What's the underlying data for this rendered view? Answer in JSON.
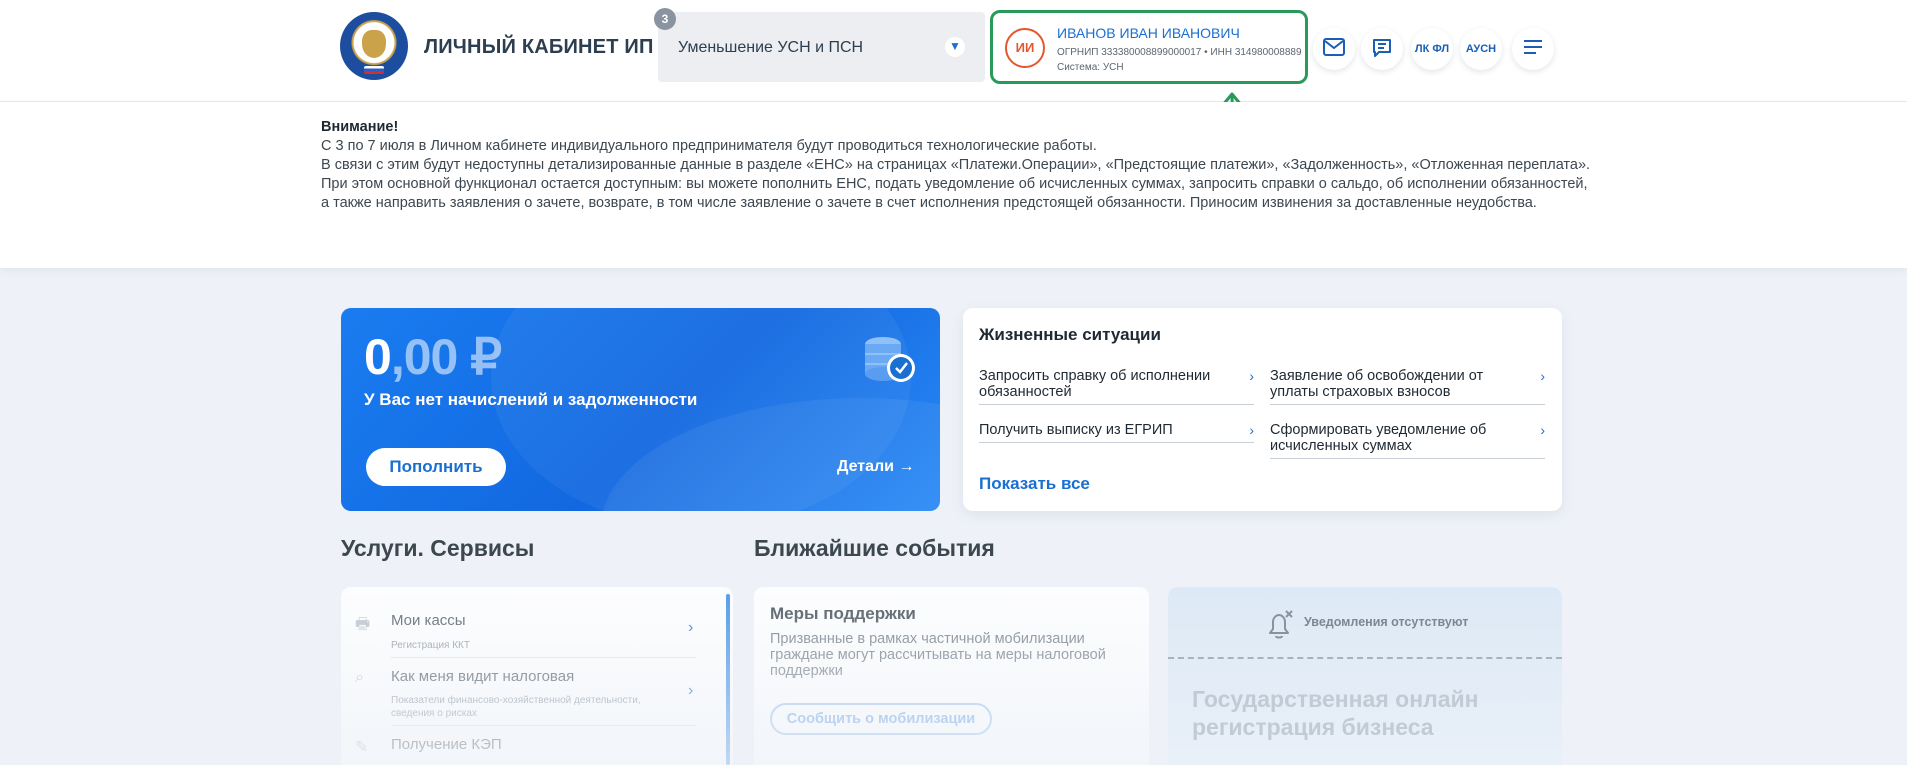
{
  "header": {
    "brand": "ЛИЧНЫЙ КАБИНЕТ ИП",
    "selector": {
      "badge": "3",
      "label": "Уменьшение УСН и ПСН"
    },
    "profile": {
      "initials": "ИИ",
      "name": "ИВАНОВ ИВАН ИВАНОВИЧ",
      "ids": "ОГРНИП 333380008899000017 • ИНН 314980008889",
      "system": "Система: УСН"
    },
    "buttons": {
      "lk_fl": "ЛК ФЛ",
      "ausn": "АУСН"
    }
  },
  "notice": {
    "title": "Внимание!",
    "lines": [
      "С 3 по 7 июля в Личном кабинете индивидуального предпринимателя будут проводиться технологические работы.",
      "В связи с этим будут недоступны детализированные данные в разделе «ЕНС» на страницах «Платежи.Операции», «Предстоящие платежи», «Задолженность», «Отложенная переплата».",
      "При этом основной функционал остается доступным: вы можете пополнить ЕНС, подать уведомление об исчисленных суммах, запросить справки о сальдо, об исполнении обязанностей, а также направить заявления о зачете, возврате, в том числе заявление о зачете в счет исполнения предстоящей обязанности. Приносим извинения за доставленные неудобства."
    ]
  },
  "balance": {
    "amount_int": "0",
    "amount_dec": ",00 ₽",
    "message": "У Вас нет начислений и задолженности",
    "topup_label": "Пополнить",
    "details_label": "Детали"
  },
  "life": {
    "title": "Жизненные ситуации",
    "items": [
      "Запросить справку об исполнении обязанностей",
      "Заявление об освобождении от уплаты страховых взносов",
      "Получить выписку из ЕГРИП",
      "Сформировать уведомление об исчисленных суммах"
    ],
    "show_all": "Показать все"
  },
  "services": {
    "title": "Услуги. Сервисы",
    "items": [
      {
        "name": "Мои кассы",
        "sub": "Регистрация ККТ"
      },
      {
        "name": "Как меня видит налоговая",
        "sub": "Показатели финансово-хозяйственной деятельности, сведения о рисках"
      },
      {
        "name": "Получение КЭП",
        "sub": ""
      }
    ]
  },
  "events": {
    "title": "Ближайшие события",
    "support": {
      "title": "Меры поддержки",
      "desc": "Призванные в рамках частичной мобилизации граждане могут рассчитывать на меры налоговой поддержки",
      "button": "Сообщить о мобилизации"
    },
    "notifications_empty": "Уведомления отсутствуют",
    "promo": "Государственная онлайн регистрация бизнеса"
  },
  "colors": {
    "accent": "#1a6fd1",
    "highlight": "#2a9a5b",
    "avatar": "#e4572e"
  }
}
